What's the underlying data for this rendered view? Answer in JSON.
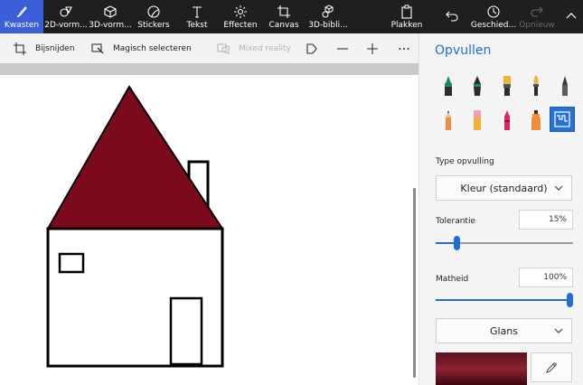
{
  "topbar": {
    "tools": [
      {
        "label": "Kwasten",
        "icon": "brush-icon",
        "active": true
      },
      {
        "label": "2D-vorm...",
        "icon": "shapes-2d-icon"
      },
      {
        "label": "3D-vorm...",
        "icon": "cube-icon"
      },
      {
        "label": "Stickers",
        "icon": "sticker-icon"
      },
      {
        "label": "Tekst",
        "icon": "text-icon"
      },
      {
        "label": "Effecten",
        "icon": "sun-effects-icon"
      },
      {
        "label": "Canvas",
        "icon": "canvas-crop-icon"
      },
      {
        "label": "3D-bibli...",
        "icon": "library-3d-icon"
      }
    ],
    "paste_label": "Plakken",
    "undo_icon": "undo-icon",
    "history_label": "Geschied...",
    "redo_label": "Opnieuw",
    "collapse_icon": "chevron-up-icon"
  },
  "toolbar": {
    "crop_label": "Bijsnijden",
    "magic_select_label": "Magisch selecteren",
    "mixed_reality_label": "Mixed reality",
    "flag_icon": "flag-icon",
    "zoom_out_icon": "minus-icon",
    "zoom_in_icon": "plus-icon",
    "more_icon": "ellipsis-icon"
  },
  "panel": {
    "title": "Opvullen",
    "brushes": [
      "marker-brush-icon",
      "calligraphy-pen-icon",
      "oil-brush-icon",
      "watercolor-brush-icon",
      "pixel-pen-icon",
      "pencil-icon",
      "eraser-icon",
      "crayon-icon",
      "spray-can-icon",
      "fill-bucket-icon"
    ],
    "selected_brush": "fill-bucket-icon",
    "fill_type_label": "Type opvulling",
    "fill_type_value": "Kleur (standaard)",
    "tolerance_label": "Tolerantie",
    "tolerance_value": "15%",
    "tolerance_percent": 15,
    "opacity_label": "Matheid",
    "opacity_value": "100%",
    "opacity_percent": 100,
    "finish_value": "Glans",
    "color_swatch": "#8d2330",
    "eyedropper_icon": "eyedropper-icon"
  },
  "drawing": {
    "roof_color": "#7a0a1c",
    "line_color": "#000000"
  }
}
